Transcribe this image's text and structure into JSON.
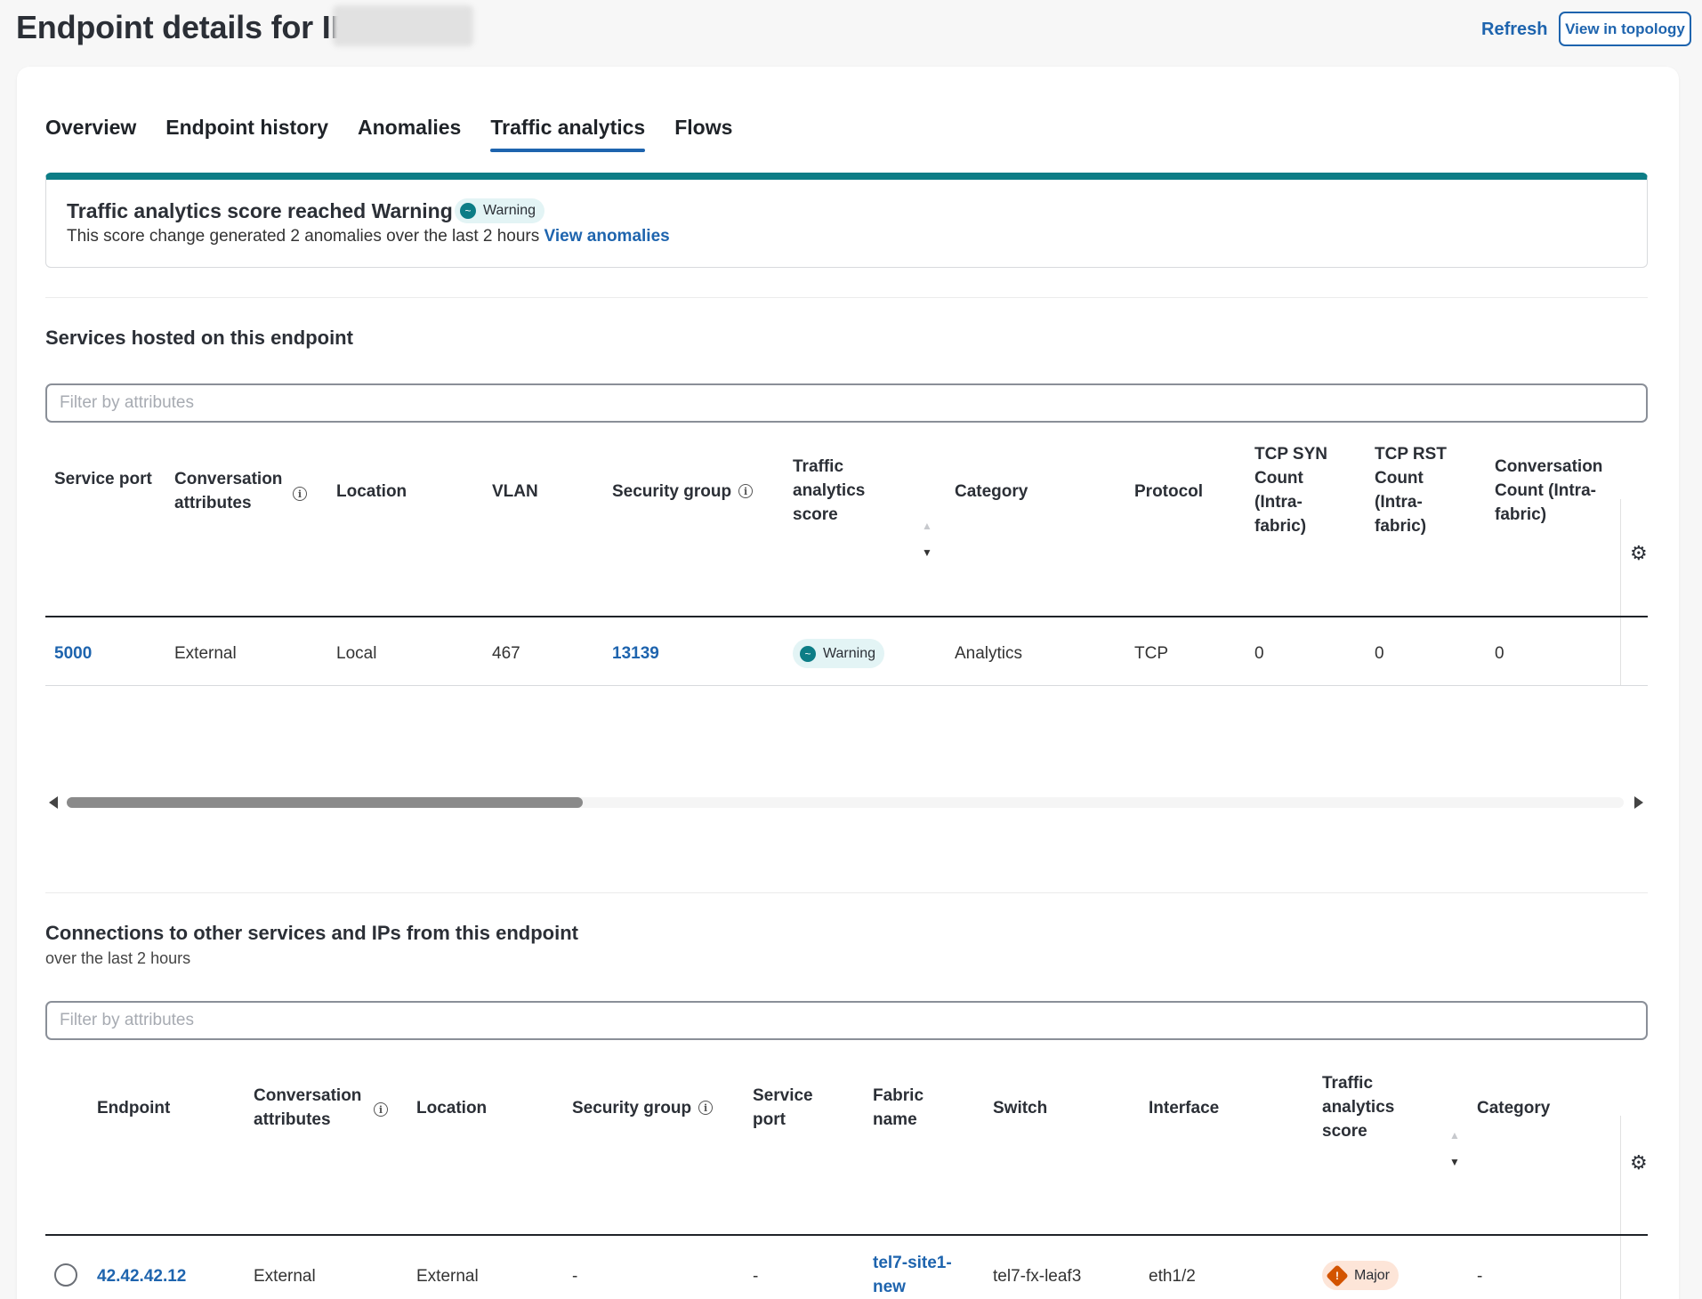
{
  "header": {
    "title": "Endpoint details for IP",
    "refresh_label": "Refresh",
    "topology_label": "View in topology"
  },
  "tabs": [
    {
      "label": "Overview"
    },
    {
      "label": "Endpoint history"
    },
    {
      "label": "Anomalies"
    },
    {
      "label": "Traffic analytics",
      "active": true
    },
    {
      "label": "Flows"
    }
  ],
  "alert": {
    "title": "Traffic analytics score reached Warning",
    "badge": "Warning",
    "text": "This score change generated 2 anomalies over the last 2 hours",
    "link": "View anomalies",
    "accent_color": "#0d7d86"
  },
  "services": {
    "title": "Services hosted on this endpoint",
    "filter_placeholder": "Filter by attributes",
    "columns": {
      "service_port": "Service port",
      "conversation_attributes": "Conversation attributes",
      "location": "Location",
      "vlan": "VLAN",
      "security_group": "Security group",
      "traffic_score": "Traffic analytics score",
      "category": "Category",
      "protocol": "Protocol",
      "tcp_syn": "TCP SYN Count (Intra-fabric)",
      "tcp_rst": "TCP RST Count (Intra-fabric)",
      "conversation_count": "Conversation Count (Intra-fabric)"
    },
    "rows": [
      {
        "service_port": "5000",
        "conversation_attributes": "External",
        "location": "Local",
        "vlan": "467",
        "security_group": "13139",
        "traffic_score": "Warning",
        "category": "Analytics",
        "protocol": "TCP",
        "tcp_syn": "0",
        "tcp_rst": "0",
        "conversation_count": "0"
      }
    ],
    "scroll_position": 0.0
  },
  "connections": {
    "title": "Connections to other services and IPs from this endpoint",
    "subtitle": "over the last 2 hours",
    "filter_placeholder": "Filter by attributes",
    "columns": {
      "endpoint": "Endpoint",
      "conversation_attributes": "Conversation attributes",
      "location": "Location",
      "security_group": "Security group",
      "service_port": "Service port",
      "fabric_name": "Fabric name",
      "switch": "Switch",
      "interface": "Interface",
      "traffic_score": "Traffic analytics score",
      "category": "Category"
    },
    "rows": [
      {
        "endpoint": "42.42.42.12",
        "conversation_attributes": "External",
        "location": "External",
        "security_group": "-",
        "service_port": "-",
        "fabric_name": "tel7-site1-new",
        "switch": "tel7-fx-leaf3",
        "interface": "eth1/2",
        "traffic_score": "Major",
        "category": "-"
      }
    ]
  },
  "colors": {
    "link": "#1e64ae",
    "warning": "#0d7d86",
    "major": "#d35400"
  },
  "icons": {
    "info": "info-icon",
    "settings": "gear-icon",
    "sort": "sort-icon"
  }
}
